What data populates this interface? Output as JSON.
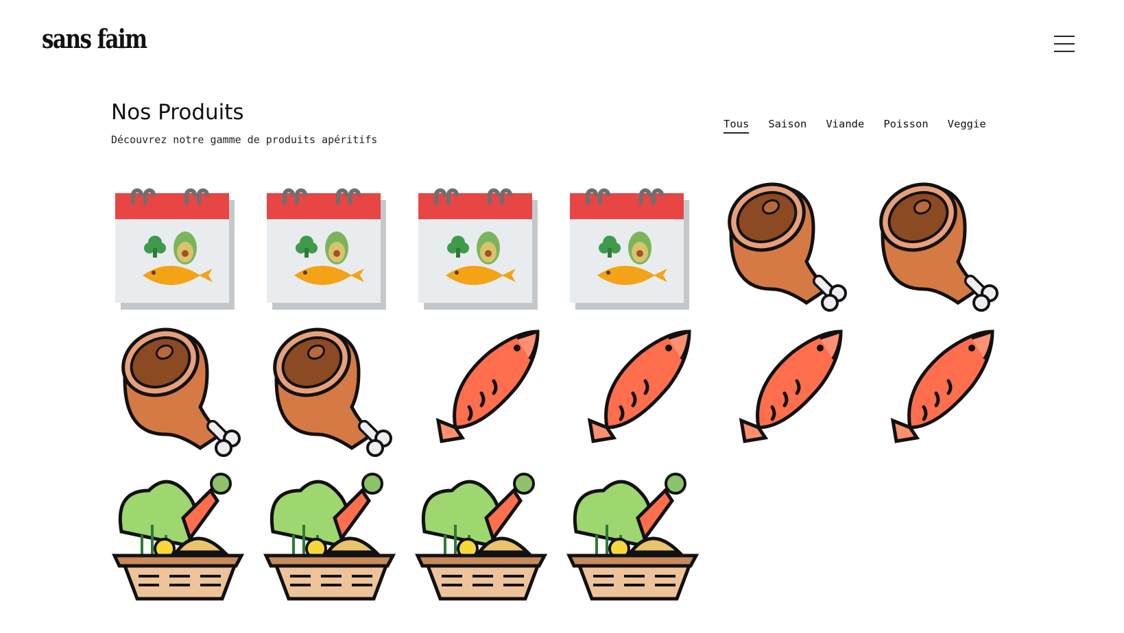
{
  "header": {
    "logo": "sans faim",
    "menu_icon": "hamburger-menu-icon"
  },
  "main": {
    "title": "Nos Produits",
    "subtitle": "Découvrez notre gamme de produits apéritifs",
    "filters": [
      {
        "label": "Tous",
        "active": true
      },
      {
        "label": "Saison",
        "active": false
      },
      {
        "label": "Viande",
        "active": false
      },
      {
        "label": "Poisson",
        "active": false
      },
      {
        "label": "Veggie",
        "active": false
      }
    ],
    "products": [
      {
        "icon": "seasonal-calendar-icon"
      },
      {
        "icon": "seasonal-calendar-icon"
      },
      {
        "icon": "seasonal-calendar-icon"
      },
      {
        "icon": "seasonal-calendar-icon"
      },
      {
        "icon": "ham-leg-icon"
      },
      {
        "icon": "ham-leg-icon"
      },
      {
        "icon": "ham-leg-icon"
      },
      {
        "icon": "ham-leg-icon"
      },
      {
        "icon": "fish-icon"
      },
      {
        "icon": "fish-icon"
      },
      {
        "icon": "fish-icon"
      },
      {
        "icon": "fish-icon"
      },
      {
        "icon": "vegetable-basket-icon"
      },
      {
        "icon": "vegetable-basket-icon"
      },
      {
        "icon": "vegetable-basket-icon"
      },
      {
        "icon": "vegetable-basket-icon"
      }
    ]
  }
}
